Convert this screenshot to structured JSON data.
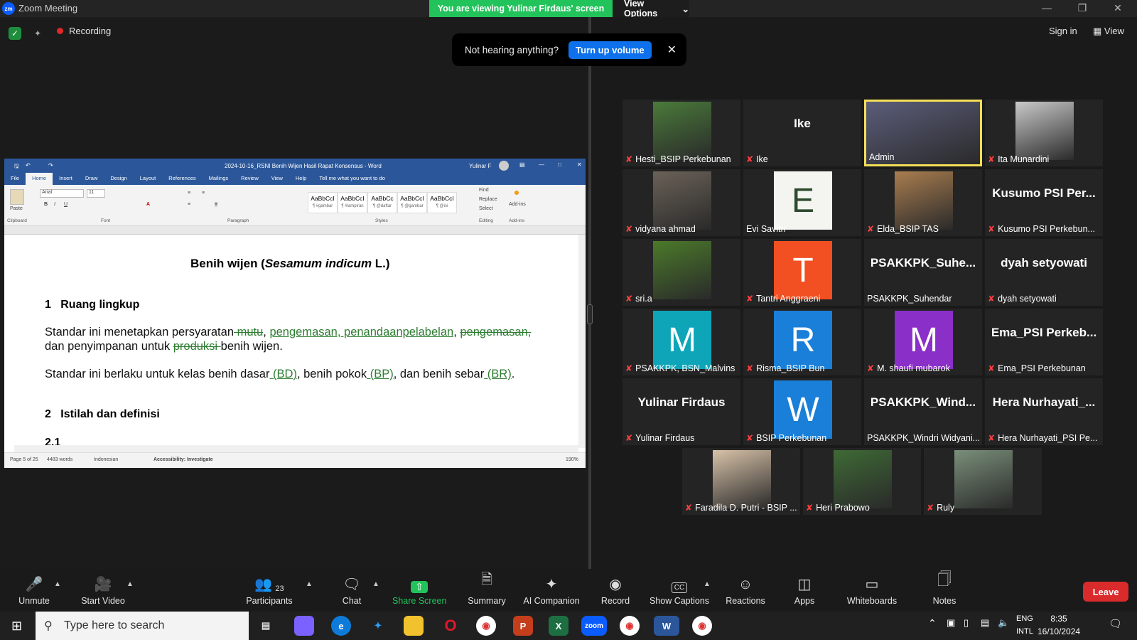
{
  "window": {
    "app_title": "Zoom Meeting"
  },
  "banner": {
    "viewing": "You are viewing Yulinar Firdaus' screen",
    "view_options": "View Options"
  },
  "top": {
    "recording": "Recording",
    "sign_in": "Sign in",
    "view": "View"
  },
  "toast": {
    "message": "Not hearing anything?",
    "button": "Turn up volume"
  },
  "word": {
    "title": "2024-10-16_RSNI Benih Wijen Hasil Rapat Konsensus - Word",
    "user": "Yulinar F",
    "tabs": [
      "File",
      "Home",
      "Insert",
      "Draw",
      "Design",
      "Layout",
      "References",
      "Mailings",
      "Review",
      "View",
      "Help",
      "Tell me what you want to do"
    ],
    "font_name": "Arial",
    "font_size": "11",
    "groups": [
      "Clipboard",
      "Font",
      "Paragraph",
      "Styles",
      "Editing",
      "Add-ins"
    ],
    "styles": [
      {
        "sample": "AaBbCcI",
        "name": "¶ #gambar"
      },
      {
        "sample": "AaBbCcI",
        "name": "¶ #lampiran"
      },
      {
        "sample": "AaBbCc",
        "name": "¶ @daftar"
      },
      {
        "sample": "AaBbCcI",
        "name": "¶ @gambar"
      },
      {
        "sample": "AaBbCcI",
        "name": "¶ @isi"
      }
    ],
    "editing": [
      "Find",
      "Replace",
      "Select"
    ],
    "paste": "Paste",
    "addins": "Add-ins",
    "doc": {
      "title_a": "Benih wijen (",
      "title_b": "Sesamum indicum",
      "title_c": " L.)",
      "s1_num": "1",
      "s1_title": "Ruang lingkup",
      "p1_a": "Standar ini menetapkan persyaratan",
      "p1_del1": " mutu",
      "p1_b": ", ",
      "p1_ins1": "pengemasan, penandaanpelabelan",
      "p1_c": ", ",
      "p1_del2": "pengemasan,",
      "p1_d": "dan penyimpanan untuk ",
      "p1_del3": "produksi ",
      "p1_e": "benih wijen.",
      "p2_a": "Standar ini berlaku untuk kelas benih dasar",
      "p2_ins1": " (BD)",
      "p2_b": ", benih pokok",
      "p2_ins2": " (BP)",
      "p2_c": ", dan benih sebar",
      "p2_ins3": " (BR)",
      "p2_d": ".",
      "s2_num": "2",
      "s2_title": "Istilah dan definisi",
      "s21": "2.1"
    },
    "status": {
      "page": "Page 5 of 25",
      "words": "4483 words",
      "language": "Indonesian",
      "accessibility": "Accessibility: Investigate",
      "zoom": "190%"
    }
  },
  "participants": [
    {
      "name": "Hesti_BSIP Perkebunan",
      "muted": true,
      "type": "photo",
      "color": "#4a7a3a"
    },
    {
      "name": "Ike",
      "big": "Ike",
      "muted": true,
      "type": "text"
    },
    {
      "name": "Admin",
      "muted": false,
      "type": "photo",
      "color": "#5b5d7a",
      "active": true
    },
    {
      "name": "Ita Munardini",
      "muted": true,
      "type": "photo",
      "color": "#c9c9c9"
    },
    {
      "name": "vidyana ahmad",
      "muted": true,
      "type": "photo",
      "color": "#6b6258"
    },
    {
      "name": "Evi Savitri",
      "muted": false,
      "type": "letter",
      "letter": "E",
      "color": "#f4f4f0",
      "fg": "#2d4a2d"
    },
    {
      "name": "Elda_BSIP TAS",
      "muted": true,
      "type": "photo",
      "color": "#a97d4f"
    },
    {
      "name": "Kusumo PSI Perkebun...",
      "big": "Kusumo PSI Per...",
      "muted": true,
      "type": "text"
    },
    {
      "name": "sri.a",
      "muted": true,
      "type": "photo",
      "color": "#4b7a2a"
    },
    {
      "name": "Tantri Anggraeni",
      "muted": true,
      "type": "letter",
      "letter": "T",
      "color": "#f25022",
      "fg": "#ffffff"
    },
    {
      "name": "PSAKKPK_Suhendar",
      "big": "PSAKKPK_Suhe...",
      "muted": false,
      "type": "text"
    },
    {
      "name": "dyah setyowati",
      "big": "dyah setyowati",
      "muted": true,
      "type": "text"
    },
    {
      "name": "PSAKKPK, BSN_Malvins",
      "muted": true,
      "type": "letter",
      "letter": "M",
      "color": "#0ea5b8",
      "fg": "#ffffff"
    },
    {
      "name": "Risma_BSIP Bun",
      "muted": true,
      "type": "letter",
      "letter": "R",
      "color": "#1a7fd8",
      "fg": "#ffffff"
    },
    {
      "name": "M. shaufi mubarok",
      "muted": true,
      "type": "letter",
      "letter": "M",
      "color": "#8b2fc9",
      "fg": "#ffffff"
    },
    {
      "name": "Ema_PSI Perkebunan",
      "big": "Ema_PSI Perkeb...",
      "muted": true,
      "type": "text"
    },
    {
      "name": "Yulinar Firdaus",
      "big": "Yulinar Firdaus",
      "muted": true,
      "type": "text"
    },
    {
      "name": "BSIP Perkebunan",
      "muted": true,
      "type": "letter",
      "letter": "W",
      "color": "#1a7fd8",
      "fg": "#ffffff"
    },
    {
      "name": "PSAKKPK_Windri Widyani...",
      "big": "PSAKKPK_Wind...",
      "muted": false,
      "type": "text"
    },
    {
      "name": "Hera Nurhayati_PSI Pe...",
      "big": "Hera Nurhayati_...",
      "muted": true,
      "type": "text"
    },
    {
      "name": "Faradila D. Putri - BSIP ...",
      "muted": true,
      "type": "photo",
      "color": "#d8c2a8"
    },
    {
      "name": "Heri Prabowo",
      "muted": true,
      "type": "photo",
      "color": "#3e6a35"
    },
    {
      "name": "Ruly",
      "muted": true,
      "type": "photo",
      "color": "#7a8f7a"
    }
  ],
  "toolbar": {
    "unmute": "Unmute",
    "start_video": "Start Video",
    "participants": "Participants",
    "participants_count": "23",
    "chat": "Chat",
    "share": "Share Screen",
    "summary": "Summary",
    "ai": "AI Companion",
    "record": "Record",
    "captions": "Show Captions",
    "reactions": "Reactions",
    "apps": "Apps",
    "whiteboards": "Whiteboards",
    "notes": "Notes",
    "leave": "Leave"
  },
  "taskbar": {
    "search_placeholder": "Type here to search",
    "lang1": "ENG",
    "lang2": "INTL",
    "time": "8:35",
    "date": "16/10/2024"
  }
}
